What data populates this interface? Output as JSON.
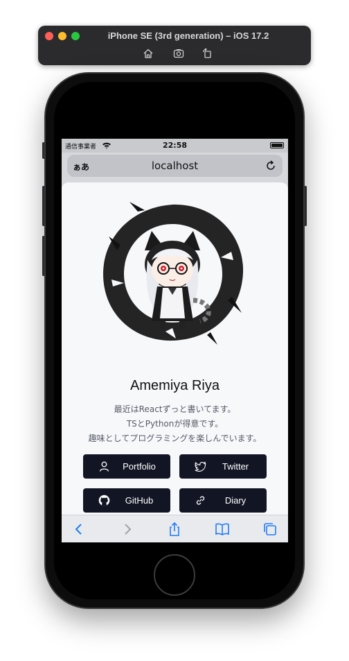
{
  "simulator": {
    "title": "iPhone SE (3rd generation) – iOS 17.2",
    "tools": [
      "home-icon",
      "screenshot-icon",
      "rotate-icon"
    ]
  },
  "statusbar": {
    "carrier": "通信事業者",
    "time": "22:58"
  },
  "addressbar": {
    "text_size_label": "ぁあ",
    "host": "localhost"
  },
  "profile": {
    "name": "Amemiya Riya",
    "bio_lines": [
      "最近はReactずっと書いてます。",
      "TSとPythonが得意です。",
      "趣味としてプログラミングを楽しんでいます。"
    ]
  },
  "links": [
    {
      "label": "Portfolio",
      "icon": "user-icon"
    },
    {
      "label": "Twitter",
      "icon": "twitter-bird-icon"
    },
    {
      "label": "GitHub",
      "icon": "github-icon"
    },
    {
      "label": "Diary",
      "icon": "link-icon"
    }
  ],
  "colors": {
    "button_bg": "#121624",
    "sheet_bg": "#f7f8fa",
    "safari_blue": "#1f7cf6"
  }
}
